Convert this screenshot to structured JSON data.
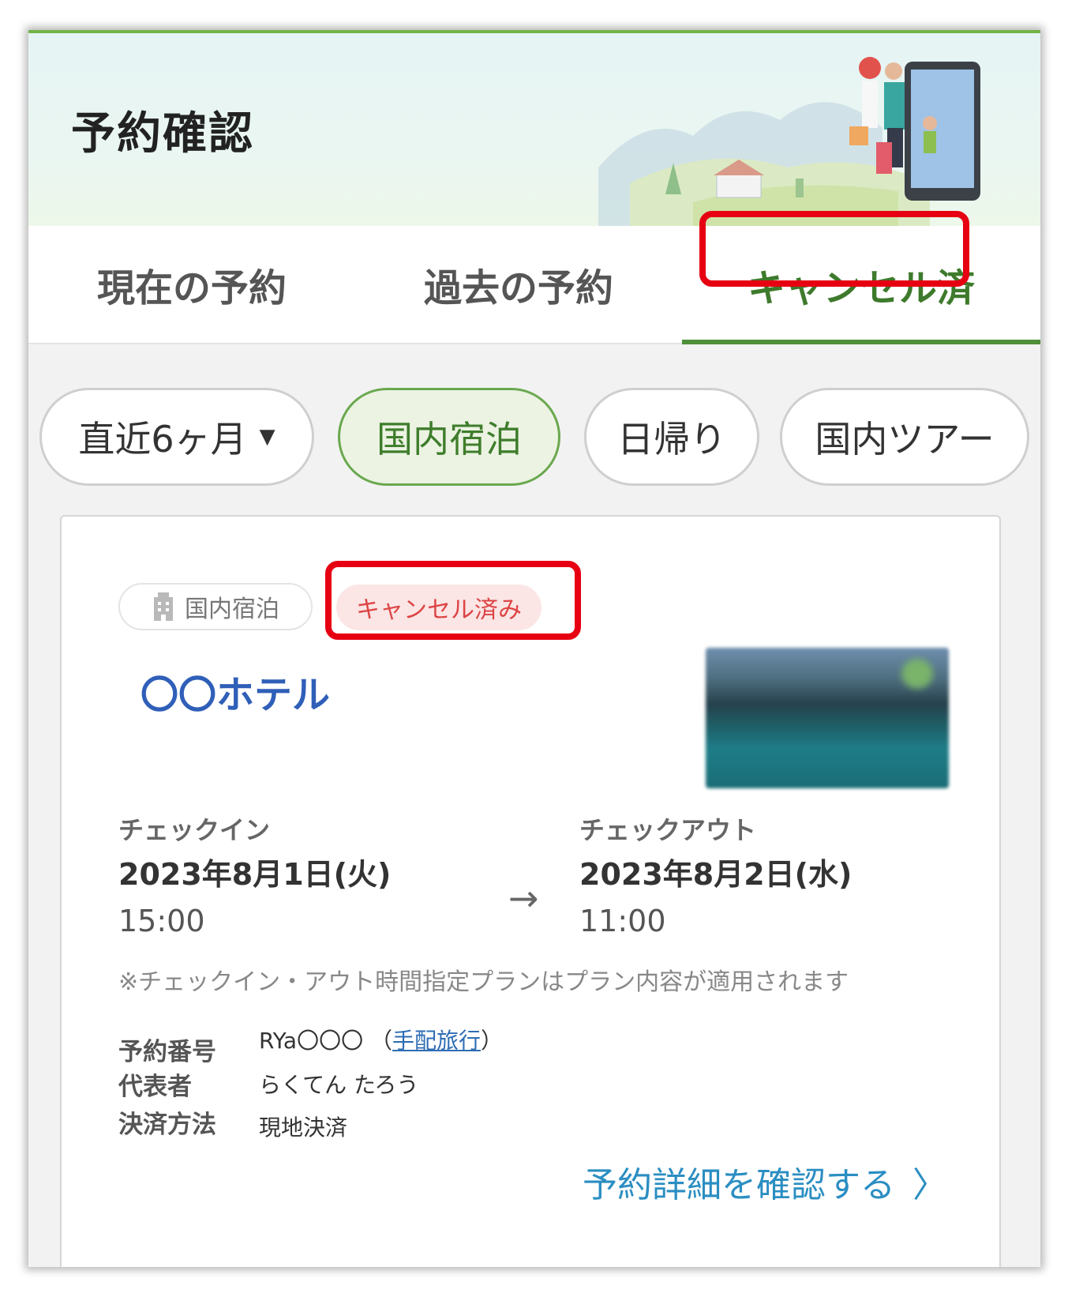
{
  "header": {
    "title": "予約確認"
  },
  "tabs": [
    {
      "label": "現在の予約"
    },
    {
      "label": "過去の予約"
    },
    {
      "label": "キャンセル済"
    }
  ],
  "filters": {
    "period": "直近6ヶ月",
    "chips": [
      "国内宿泊",
      "日帰り",
      "国内ツアー"
    ]
  },
  "booking": {
    "category": "国内宿泊",
    "status": "キャンセル済み",
    "hotel_name": "〇〇ホテル",
    "checkin_label": "チェックイン",
    "checkin_date": "2023年8月1日(火)",
    "checkin_time": "15:00",
    "checkout_label": "チェックアウト",
    "checkout_date": "2023年8月2日(水)",
    "checkout_time": "11:00",
    "note": "※チェックイン・アウト時間指定プランはプラン内容が適用されます",
    "reservation_no_label": "予約番号",
    "reservation_no": "RYa〇〇〇",
    "arrangement_link": "手配旅行",
    "representative_label": "代表者",
    "representative": "らくてん たろう",
    "payment_label": "決済方法",
    "payment": "現地決済",
    "detail_link": "予約詳細を確認する"
  },
  "colors": {
    "accent_green": "#4f8f3a",
    "highlight_red": "#e60012",
    "link_blue": "#2b8ec2",
    "hotel_blue": "#2f5fb8"
  }
}
